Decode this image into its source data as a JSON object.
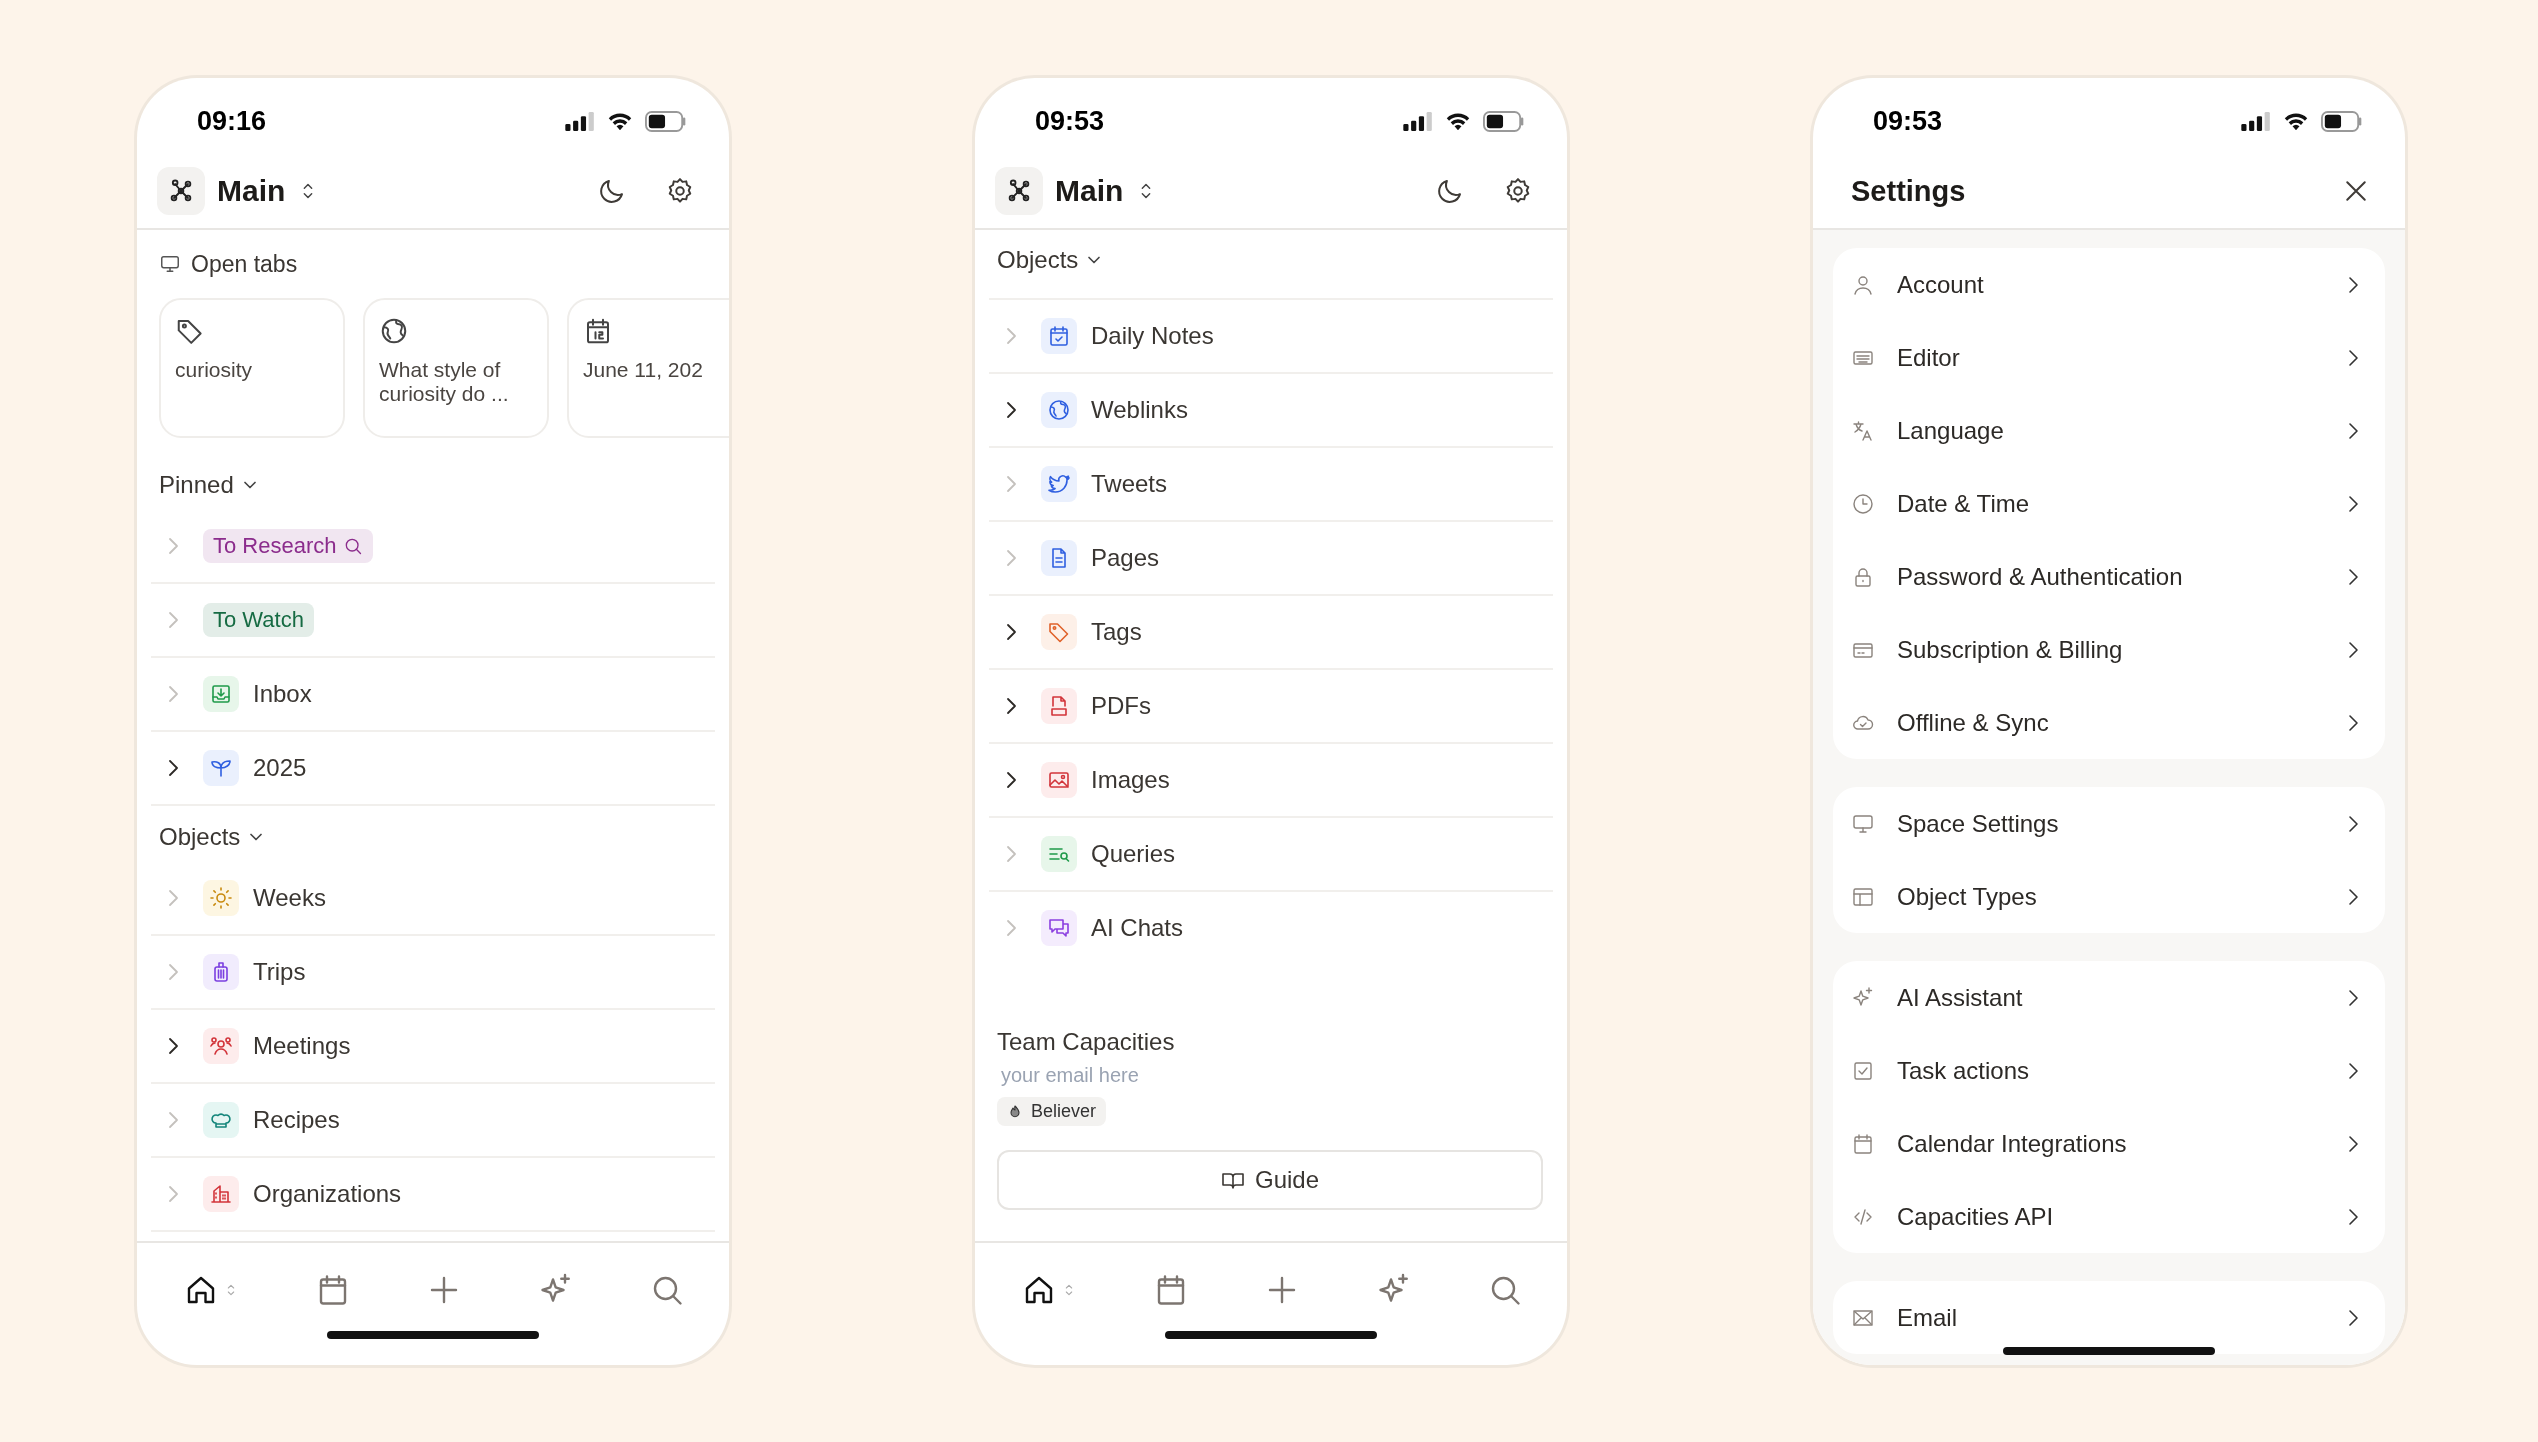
{
  "phones": [
    {
      "status": {
        "time": "09:16"
      },
      "header": {
        "kind": "space",
        "title": "Main"
      },
      "open_tabs": {
        "title": "Open tabs",
        "tabs": [
          {
            "kind": "tag",
            "label": "curiosity"
          },
          {
            "kind": "globe",
            "label": "What style of curiosity do ..."
          },
          {
            "kind": "date",
            "label": "June 11, 202"
          }
        ]
      },
      "sections": [
        {
          "title": "Pinned",
          "expanded": true,
          "items": [
            {
              "kind": "search-chip",
              "label": "To Research",
              "color": "#8b2c8c",
              "expandable": false
            },
            {
              "kind": "chip",
              "label": "To Watch",
              "color": "#166b43",
              "expandable": false
            },
            {
              "kind": "inbox",
              "label": "Inbox",
              "expandable": false
            },
            {
              "kind": "sprout",
              "label": "2025",
              "expandable": true
            }
          ]
        },
        {
          "title": "Objects",
          "expanded": true,
          "items": [
            {
              "kind": "sun",
              "label": "Weeks",
              "expandable": false
            },
            {
              "kind": "suitcase",
              "label": "Trips",
              "expandable": false
            },
            {
              "kind": "people",
              "label": "Meetings",
              "expandable": true
            },
            {
              "kind": "chef",
              "label": "Recipes",
              "expandable": false
            },
            {
              "kind": "building",
              "label": "Organizations",
              "expandable": false
            }
          ]
        }
      ],
      "nav": [
        {
          "kind": "home",
          "selected": true
        },
        {
          "kind": "calendar",
          "selected": false
        },
        {
          "kind": "plus",
          "selected": false
        },
        {
          "kind": "sparkle",
          "selected": false
        },
        {
          "kind": "search",
          "selected": false
        }
      ]
    },
    {
      "status": {
        "time": "09:53"
      },
      "header": {
        "kind": "space",
        "title": "Main"
      },
      "sections": [
        {
          "title": "Objects",
          "expanded": true,
          "items": [
            {
              "kind": "daily",
              "label": "Daily Notes",
              "expandable": false
            },
            {
              "kind": "weblink",
              "label": "Weblinks",
              "expandable": true
            },
            {
              "kind": "bird",
              "label": "Tweets",
              "expandable": false
            },
            {
              "kind": "page",
              "label": "Pages",
              "expandable": false
            },
            {
              "kind": "tag",
              "label": "Tags",
              "expandable": true
            },
            {
              "kind": "pdf",
              "label": "PDFs",
              "expandable": true
            },
            {
              "kind": "image",
              "label": "Images",
              "expandable": true
            },
            {
              "kind": "query",
              "label": "Queries",
              "expandable": false
            },
            {
              "kind": "chat",
              "label": "AI Chats",
              "expandable": false
            }
          ]
        }
      ],
      "team": {
        "name": "Team Capacities",
        "email": "your email here",
        "badge": "Believer",
        "button": "Guide"
      },
      "nav": [
        {
          "kind": "home",
          "selected": true
        },
        {
          "kind": "calendar",
          "selected": false
        },
        {
          "kind": "plus",
          "selected": false
        },
        {
          "kind": "sparkle",
          "selected": false
        },
        {
          "kind": "search",
          "selected": false
        }
      ]
    },
    {
      "status": {
        "time": "09:53"
      },
      "header": {
        "kind": "modal",
        "title": "Settings"
      },
      "settings": [
        [
          {
            "kind": "user",
            "label": "Account"
          },
          {
            "kind": "editor",
            "label": "Editor"
          },
          {
            "kind": "translate",
            "label": "Language"
          },
          {
            "kind": "clock",
            "label": "Date & Time"
          },
          {
            "kind": "lock",
            "label": "Password & Authentication"
          },
          {
            "kind": "card",
            "label": "Subscription & Billing"
          },
          {
            "kind": "cloud",
            "label": "Offline & Sync"
          }
        ],
        [
          {
            "kind": "monitor",
            "label": "Space Settings"
          },
          {
            "kind": "layout",
            "label": "Object Types"
          }
        ],
        [
          {
            "kind": "sparkle",
            "label": "AI Assistant"
          },
          {
            "kind": "checkbox",
            "label": "Task actions"
          },
          {
            "kind": "calendar",
            "label": "Calendar Integrations"
          },
          {
            "kind": "code",
            "label": "Capacities API"
          }
        ],
        [
          {
            "kind": "mail",
            "label": "Email"
          }
        ]
      ]
    }
  ]
}
